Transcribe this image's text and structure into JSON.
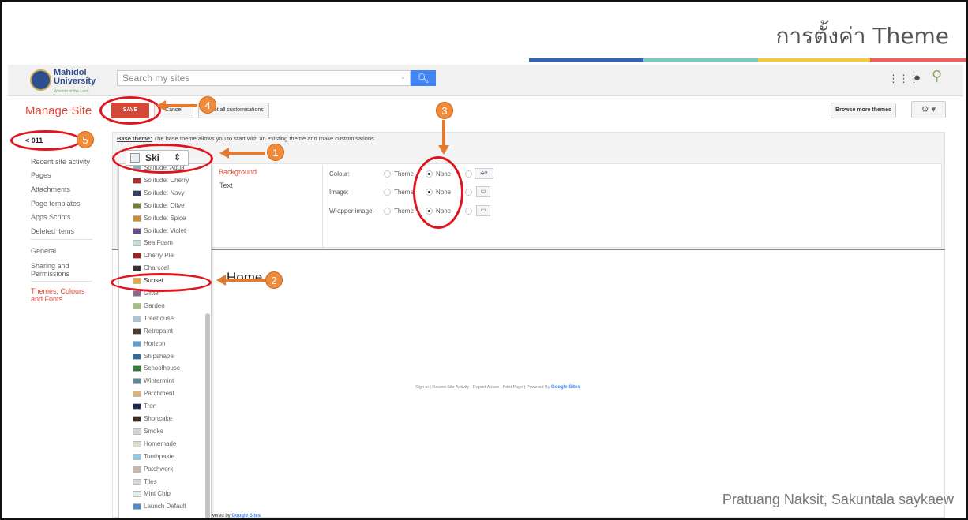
{
  "slide": {
    "title": "การตั้งค่า Theme",
    "credits": "Pratuang Naksit, Sakuntala  saykaew",
    "accent_colors": [
      "#2f66b3",
      "#7ac7c4",
      "#f5c842",
      "#e9615e"
    ]
  },
  "topbar": {
    "logo_line1": "Mahidol",
    "logo_line2": "University",
    "logo_tagline": "Wisdom of the Land",
    "search_placeholder": "Search my sites",
    "search_icon": "search-icon",
    "apps_icon": "apps-grid-icon",
    "notify_icon": "notifications-icon",
    "account_icon": "account-icon"
  },
  "manage": {
    "title": "Manage Site",
    "save_label": "SAVE",
    "cancel_label": "Cancel",
    "reset_label": "Reset all customisations",
    "browse_label": "Browse more themes",
    "settings_label": "⚙ ▾"
  },
  "sidebar": {
    "back_label": "< 011",
    "items": [
      "Recent site activity",
      "Pages",
      "Attachments",
      "Page templates",
      "Apps Scripts",
      "Deleted items",
      "General",
      "Sharing and Permissions",
      "Themes, Colours and Fonts"
    ]
  },
  "theme_panel": {
    "base_theme_bold": "Base theme:",
    "base_theme_text": "The base theme allows you to start with an existing theme and make customisations.",
    "selected_theme": "Ski",
    "sections": [
      "Background",
      "Text"
    ],
    "rows": [
      {
        "label": "Colour:",
        "opt1": "Theme",
        "opt2": "None"
      },
      {
        "label": "Image:",
        "opt1": "Theme",
        "opt2": "None"
      },
      {
        "label": "Wrapper image:",
        "opt1": "Theme",
        "opt2": "None"
      }
    ]
  },
  "dropdown": {
    "items": [
      {
        "label": "Solitude: Aqua",
        "color": "#7fb3c8"
      },
      {
        "label": "Solitude: Cherry",
        "color": "#b02a2a"
      },
      {
        "label": "Solitude: Navy",
        "color": "#2d3f66"
      },
      {
        "label": "Solitude: Olive",
        "color": "#7a8033"
      },
      {
        "label": "Solitude: Spice",
        "color": "#d08a2a"
      },
      {
        "label": "Solitude: Violet",
        "color": "#6b4c8a"
      },
      {
        "label": "Sea Foam",
        "color": "#bfe0dc"
      },
      {
        "label": "Cherry Pie",
        "color": "#a82020"
      },
      {
        "label": "Charcoal",
        "color": "#333333"
      },
      {
        "label": "Sunset",
        "color": "#e8a73a"
      },
      {
        "label": "Glitter",
        "color": "#8a6b9a"
      },
      {
        "label": "Garden",
        "color": "#9cc37a"
      },
      {
        "label": "Treehouse",
        "color": "#a7c7de"
      },
      {
        "label": "Retropaint",
        "color": "#4a3a30"
      },
      {
        "label": "Horizon",
        "color": "#5a9fd4"
      },
      {
        "label": "Shipshape",
        "color": "#2a6fa8"
      },
      {
        "label": "Schoolhouse",
        "color": "#2f7d3a"
      },
      {
        "label": "Wintermint",
        "color": "#5a8a9a"
      },
      {
        "label": "Parchment",
        "color": "#d9b77a"
      },
      {
        "label": "Tron",
        "color": "#1a2a4a"
      },
      {
        "label": "Shortcake",
        "color": "#3a2a20"
      },
      {
        "label": "Smoke",
        "color": "#cfd6dc"
      },
      {
        "label": "Homemade",
        "color": "#e0dcd0"
      },
      {
        "label": "Toothpaste",
        "color": "#8ecbe6"
      },
      {
        "label": "Patchwork",
        "color": "#c9b8a8"
      },
      {
        "label": "Tiles",
        "color": "#d8d8d8"
      },
      {
        "label": "Mint Chip",
        "color": "#dff0e4"
      },
      {
        "label": "Launch Default",
        "color": "#4a8ad4"
      }
    ]
  },
  "preview": {
    "heading": "Home",
    "footer": "Sign in  |  Recent Site Activity  |  Report Abuse  |  Print Page  |  Powered By",
    "footer_brand": "Google Sites",
    "powered_prefix": "Powered by",
    "powered_brand": "Google Sites"
  },
  "annotations": [
    "1",
    "2",
    "3",
    "4",
    "5"
  ]
}
